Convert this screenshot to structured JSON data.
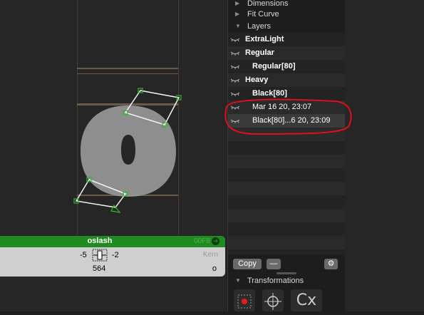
{
  "panel": {
    "sections": [
      {
        "label": "Dimensions",
        "expanded": false
      },
      {
        "label": "Fit Curve",
        "expanded": false
      },
      {
        "label": "Layers",
        "expanded": true
      }
    ],
    "layers": [
      {
        "label": "ExtraLight",
        "kind": "master"
      },
      {
        "label": "Regular",
        "kind": "master"
      },
      {
        "label": "Regular[80]",
        "kind": "sub"
      },
      {
        "label": "Heavy",
        "kind": "master"
      },
      {
        "label": "Black[80]",
        "kind": "sub"
      },
      {
        "label": "Mar 16 20, 23:07",
        "kind": "backup"
      },
      {
        "label": "Black[80]...6 20, 23:09",
        "kind": "backup"
      }
    ],
    "buttons": {
      "copy": "Copy",
      "remove": "—"
    },
    "transformations_label": "Transformations",
    "tool_labels": {
      "cx": "Cx"
    }
  },
  "glyph_info": {
    "name": "oslash",
    "unicode": "00F8",
    "lsb": "-5",
    "rsb": "-2",
    "width": "564",
    "kern_label": "Kern",
    "kern_value": "o"
  },
  "colors": {
    "info_bar_green": "#1f8a1f",
    "annotation_red": "#e0101a",
    "node_green": "#2fb52f",
    "glyph_fill": "#9a9a9a"
  }
}
